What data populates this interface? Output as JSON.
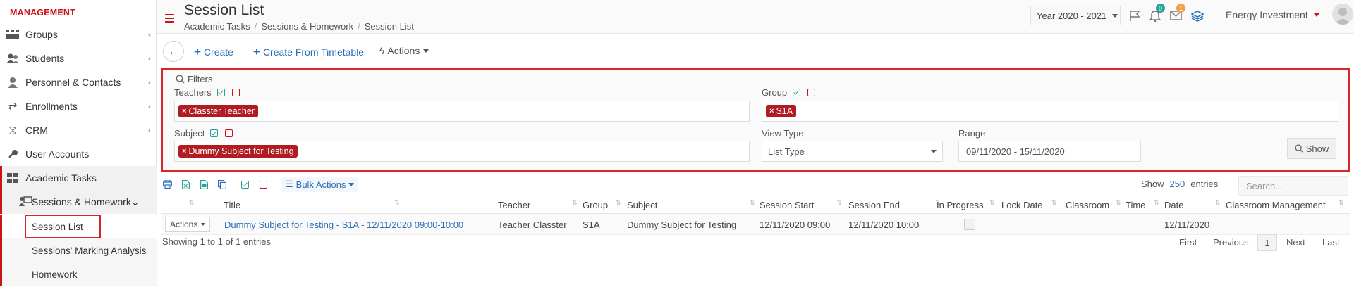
{
  "sidebar": {
    "section": "MANAGEMENT",
    "items": [
      {
        "label": "Groups",
        "icon": "groups-icon"
      },
      {
        "label": "Students",
        "icon": "students-icon"
      },
      {
        "label": "Personnel & Contacts",
        "icon": "person-icon"
      },
      {
        "label": "Enrollments",
        "icon": "exchange-icon"
      },
      {
        "label": "CRM",
        "icon": "shuffle-icon"
      },
      {
        "label": "User Accounts",
        "icon": "key-icon"
      },
      {
        "label": "Academic Tasks",
        "icon": "dashboard-icon"
      },
      {
        "label": "Sessions & Homework",
        "icon": "sessions-icon"
      }
    ],
    "subitems": [
      "Session List",
      "Sessions' Marking Analysis",
      "Homework"
    ]
  },
  "header": {
    "title": "Session List",
    "breadcrumb": [
      "Academic Tasks",
      "Sessions & Homework",
      "Session List"
    ],
    "year": "Year 2020 - 2021",
    "notifications_count": "0",
    "messages_count": "1",
    "user": "Energy Investment",
    "accent": "#c9141a"
  },
  "toolbar": {
    "create": "Create",
    "create_from_timetable": "Create From Timetable",
    "actions": "Actions"
  },
  "filters": {
    "title": "Filters",
    "teachers_label": "Teachers",
    "teachers_tag": "Classter Teacher",
    "group_label": "Group",
    "group_tag": "S1A",
    "subject_label": "Subject",
    "subject_tag": "Dummy Subject for Testing",
    "view_type_label": "View Type",
    "view_type_value": "List Type",
    "range_label": "Range",
    "range_value": "09/11/2020 - 15/11/2020",
    "show_button": "Show"
  },
  "table": {
    "bulk_actions": "Bulk Actions",
    "show_label": "Show",
    "entries_count": "250",
    "entries_label": "entries",
    "search_placeholder": "Search...",
    "columns": [
      "Title",
      "Teacher",
      "Group",
      "Subject",
      "Session Start",
      "Session End",
      "In Progress",
      "Lock Date",
      "Classroom",
      "Time",
      "Date",
      "Classroom Management"
    ],
    "rows": [
      {
        "actions": "Actions",
        "title": "Dummy Subject for Testing - S1A - 12/11/2020 09:00-10:00",
        "teacher": "Teacher Classter",
        "group": "S1A",
        "subject": "Dummy Subject for Testing",
        "session_start": "12/11/2020 09:00",
        "session_end": "12/11/2020 10:00",
        "date": "12/11/2020"
      }
    ],
    "info": "Showing 1 to 1 of 1 entries",
    "pager": {
      "first": "First",
      "previous": "Previous",
      "current": "1",
      "next": "Next",
      "last": "Last"
    }
  }
}
